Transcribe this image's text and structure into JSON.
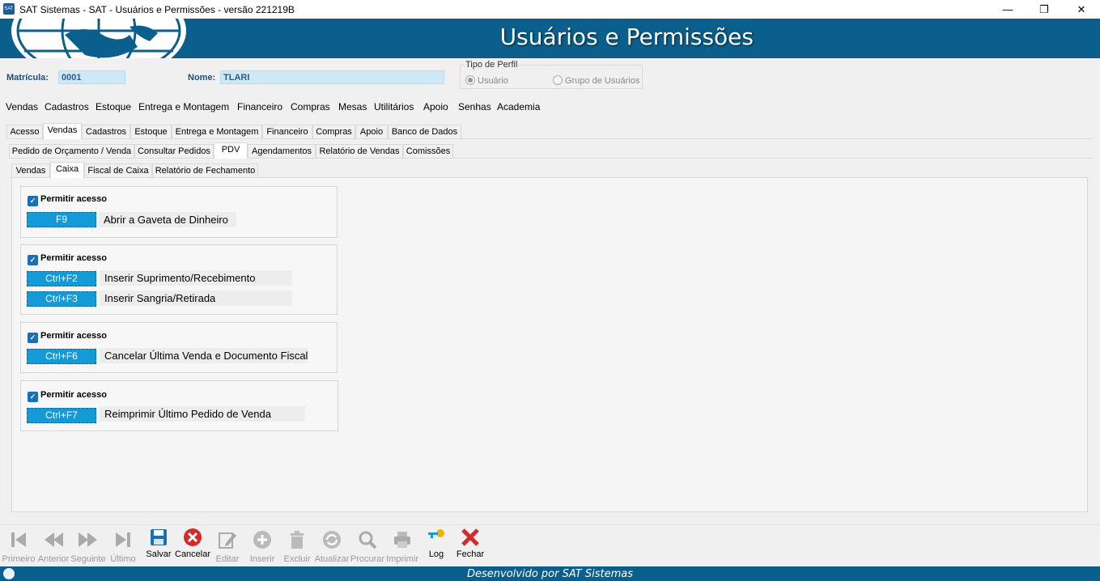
{
  "window": {
    "title": "SAT Sistemas - SAT - Usuários e Permissões - versão 221219B",
    "icon_label": "SAT",
    "minimize": "—",
    "restore": "❐",
    "close": "✕"
  },
  "header": {
    "title": "Usuários e Permissões"
  },
  "user": {
    "matricula_label": "Matrícula:",
    "matricula_value": "0001",
    "nome_label": "Nome:",
    "nome_value": "TLARI"
  },
  "perfil": {
    "legend": "Tipo de Perfil",
    "options": [
      "Usuário",
      "Grupo de Usuários"
    ],
    "selected": "Usuário"
  },
  "menu": [
    "Vendas",
    "Cadastros",
    "Estoque",
    "Entrega e Montagem",
    "Financeiro",
    "Compras",
    "Mesas",
    "Utilitários",
    "Apoio",
    "Senhas",
    "Academia"
  ],
  "tabs1": [
    "Acesso",
    "Vendas",
    "Cadastros",
    "Estoque",
    "Entrega e Montagem",
    "Financeiro",
    "Compras",
    "Apoio",
    "Banco de Dados"
  ],
  "tabs2": [
    "Pedido de Orçamento / Venda",
    "Consultar Pedidos",
    "PDV",
    "Agendamentos",
    "Relatório de Vendas",
    "Comissões"
  ],
  "tabs3": [
    "Vendas",
    "Caixa",
    "Fiscal de Caixa",
    "Relatório de Fechamento"
  ],
  "groups": [
    {
      "check_label": "Permitir acesso",
      "items": [
        {
          "key": "F9",
          "desc": "Abrir a Gaveta de Dinheiro"
        }
      ]
    },
    {
      "check_label": "Permitir acesso",
      "items": [
        {
          "key": "Ctrl+F2",
          "desc": "Inserir Suprimento/Recebimento"
        },
        {
          "key": "Ctrl+F3",
          "desc": "Inserir Sangria/Retirada"
        }
      ]
    },
    {
      "check_label": "Permitir acesso",
      "items": [
        {
          "key": "Ctrl+F6",
          "desc": "Cancelar Última Venda e Documento Fiscal"
        }
      ]
    },
    {
      "check_label": "Permitir acesso",
      "items": [
        {
          "key": "Ctrl+F7",
          "desc": "Reimprimir Último Pedido de Venda"
        }
      ]
    }
  ],
  "toolbar": {
    "primeiro": "Primeiro",
    "anterior": "Anterior",
    "seguinte": "Seguinte",
    "ultimo": "Último",
    "salvar": "Salvar",
    "cancelar": "Cancelar",
    "editar": "Editar",
    "inserir": "Inserir",
    "excluir": "Excluir",
    "atualizar": "Atualizar",
    "procurar": "Procurar",
    "imprimir": "Imprimir",
    "log": "Log",
    "fechar": "Fechar"
  },
  "footer": {
    "text": "Desenvolvido por SAT Sistemas"
  },
  "colors": {
    "brand": "#0a5f8c",
    "key_bg": "#159ad8",
    "check": "#1a6fb5",
    "cancel_red": "#d42a2a"
  }
}
